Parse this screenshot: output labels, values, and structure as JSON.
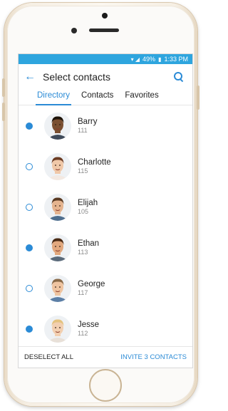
{
  "status_bar": {
    "signal_icon": "wifi-signal-icon",
    "battery": "49%",
    "battery_icon": "battery-icon",
    "time": "1:33 PM"
  },
  "header": {
    "back_icon": "arrow-left-icon",
    "title": "Select contacts",
    "search_icon": "search-icon"
  },
  "tabs": [
    {
      "label": "Directory",
      "active": true
    },
    {
      "label": "Contacts",
      "active": false
    },
    {
      "label": "Favorites",
      "active": false
    }
  ],
  "contacts": [
    {
      "name": "Barry",
      "ext": "111",
      "selected": true,
      "skin": "#7a4f31",
      "hair": "#1c1208",
      "shirt": "#3e4a5a"
    },
    {
      "name": "Charlotte",
      "ext": "115",
      "selected": false,
      "skin": "#f0c8a8",
      "hair": "#6b3b22",
      "shirt": "#f3e9e2"
    },
    {
      "name": "Elijah",
      "ext": "105",
      "selected": false,
      "skin": "#e5b48f",
      "hair": "#5a3a22",
      "shirt": "#4e6e8e"
    },
    {
      "name": "Ethan",
      "ext": "113",
      "selected": true,
      "skin": "#e2a87e",
      "hair": "#4a2a14",
      "shirt": "#5a6a7a"
    },
    {
      "name": "George",
      "ext": "117",
      "selected": false,
      "skin": "#efc4a0",
      "hair": "#8a6a48",
      "shirt": "#5c7fa6"
    },
    {
      "name": "Jesse",
      "ext": "112",
      "selected": true,
      "skin": "#f2cfb0",
      "hair": "#e4c27e",
      "shirt": "#e8e0d8"
    }
  ],
  "footer": {
    "deselect_label": "DESELECT ALL",
    "invite_label": "INVITE 3 CONTACTS"
  },
  "colors": {
    "accent": "#2b8bd6",
    "status_bar": "#2ea5de"
  }
}
